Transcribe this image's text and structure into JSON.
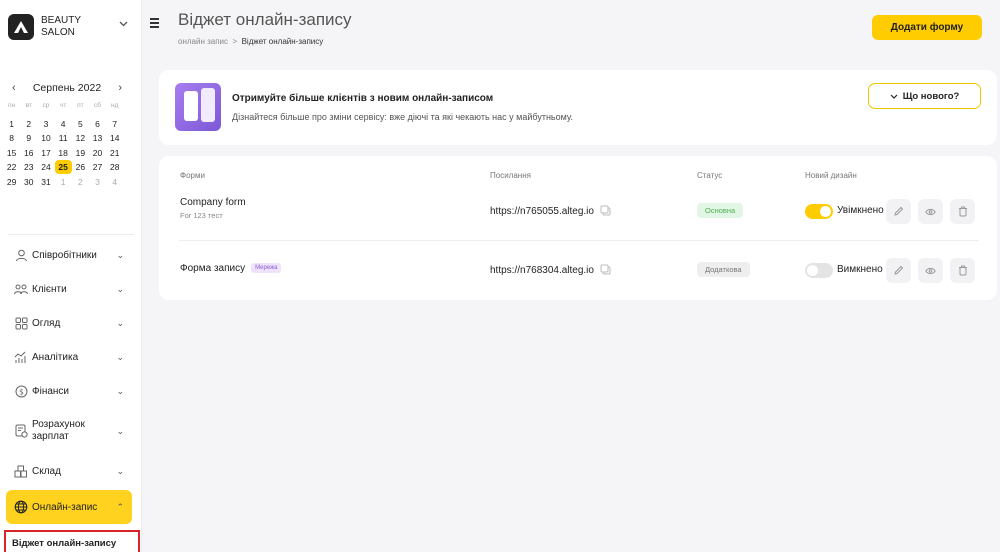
{
  "brand": {
    "name": "BEAUTY SALON"
  },
  "calendar": {
    "month_label": "Серпень 2022",
    "weekdays": [
      "пн",
      "вт",
      "ср",
      "чт",
      "пт",
      "сб",
      "нд"
    ],
    "weeks": [
      [
        "1",
        "2",
        "3",
        "4",
        "5",
        "6",
        "7"
      ],
      [
        "8",
        "9",
        "10",
        "11",
        "12",
        "13",
        "14"
      ],
      [
        "15",
        "16",
        "17",
        "18",
        "19",
        "20",
        "21"
      ],
      [
        "22",
        "23",
        "24",
        "25",
        "26",
        "27",
        "28"
      ],
      [
        "29",
        "30",
        "31",
        "1",
        "2",
        "3",
        "4"
      ]
    ],
    "today": "25"
  },
  "nav": [
    {
      "label": "Співробітники",
      "icon": "user-icon"
    },
    {
      "label": "Клієнти",
      "icon": "clients-icon"
    },
    {
      "label": "Огляд",
      "icon": "grid-icon"
    },
    {
      "label": "Аналітика",
      "icon": "analytics-icon"
    },
    {
      "label": "Фінанси",
      "icon": "dollar-icon"
    },
    {
      "label": "Розрахунок зарплат",
      "icon": "payroll-icon"
    },
    {
      "label": "Склад",
      "icon": "warehouse-icon"
    },
    {
      "label": "Онлайн-запис",
      "icon": "globe-icon"
    }
  ],
  "nav_sub": {
    "label": "Віджет онлайн-запису"
  },
  "header": {
    "title": "Віджет онлайн-запису",
    "breadcrumb_root": "онлайн запис",
    "breadcrumb_sep": ">",
    "breadcrumb_current": "Віджет онлайн-запису",
    "add_button": "Додати форму"
  },
  "banner": {
    "title": "Отримуйте більше клієнтів з новим онлайн-записом",
    "subtitle": "Дізнайтеся більше про зміни сервісу: вже діючі та які чекають нас у майбутньому.",
    "button": "Що нового?"
  },
  "table": {
    "headers": {
      "forms": "Форми",
      "link": "Посилання",
      "status": "Статус",
      "design": "Новий дизайн"
    },
    "rows": [
      {
        "name": "Company form",
        "sub": "For 123 тест",
        "tag": "",
        "link": "https://n765055.alteg.io",
        "status": "Основна",
        "toggle_label": "Увімкнено",
        "toggle_on": true
      },
      {
        "name": "Форма запису",
        "sub": "",
        "tag": "Мережа",
        "link": "https://n768304.alteg.io",
        "status": "Додаткова",
        "toggle_label": "Вимкнено",
        "toggle_on": false
      }
    ]
  },
  "colors": {
    "accent": "#ffcc00",
    "highlight_border": "#d8232a"
  }
}
